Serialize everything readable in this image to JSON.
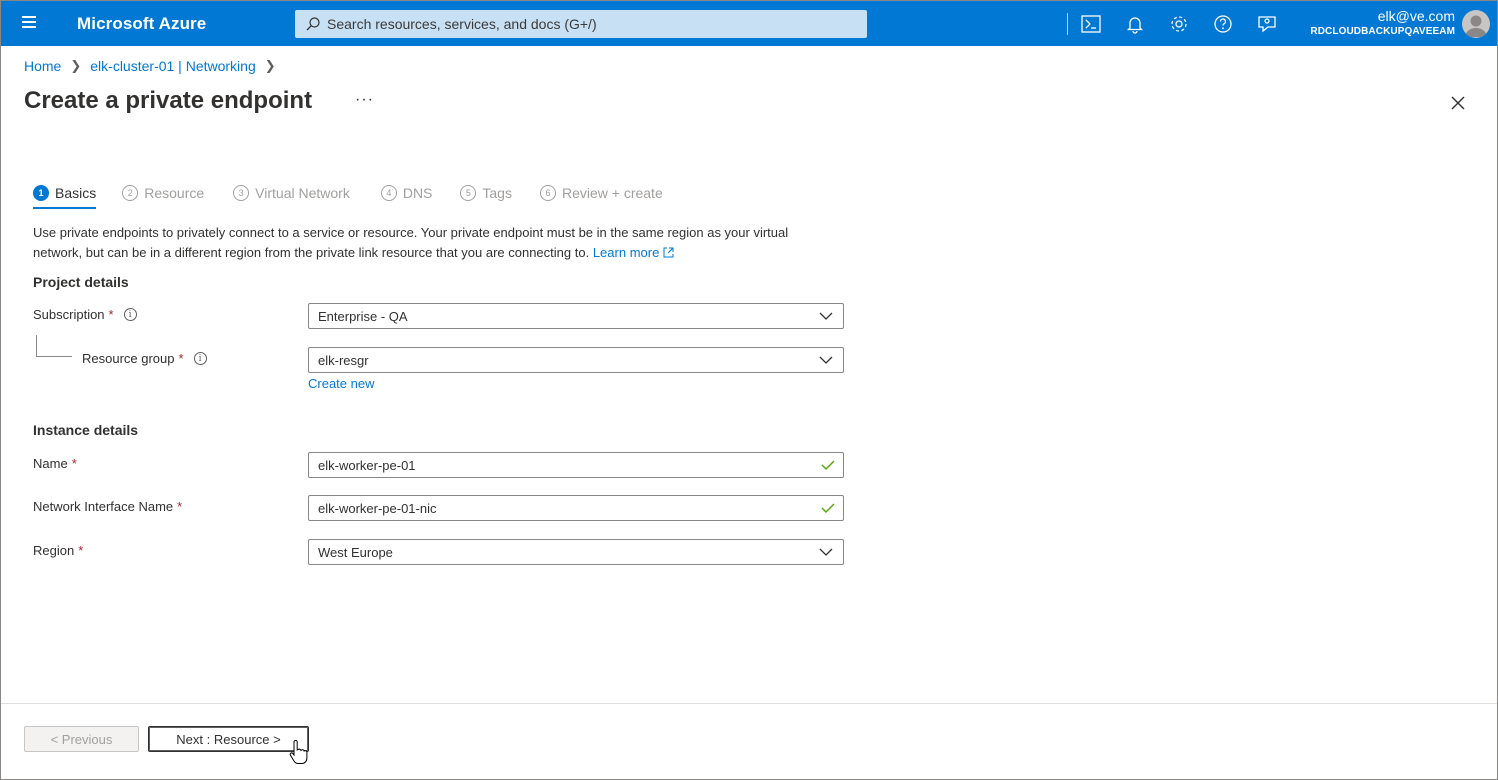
{
  "topbar": {
    "brand": "Microsoft Azure",
    "search_placeholder": "Search resources, services, and docs (G+/)",
    "account_email": "elk@ve.com",
    "account_tenant": "RDCLOUDBACKUPQAVEEAM",
    "icons": [
      "cloud-shell-icon",
      "bell-icon",
      "gear-icon",
      "help-icon",
      "feedback-icon"
    ],
    "accent": "#0078d4"
  },
  "breadcrumb": {
    "home": "Home",
    "resource": "elk-cluster-01 | Networking"
  },
  "page": {
    "title": "Create a private endpoint",
    "more": "···"
  },
  "tabs": [
    {
      "num": "1",
      "label": "Basics",
      "active": true
    },
    {
      "num": "2",
      "label": "Resource"
    },
    {
      "num": "3",
      "label": "Virtual Network"
    },
    {
      "num": "4",
      "label": "DNS"
    },
    {
      "num": "5",
      "label": "Tags"
    },
    {
      "num": "6",
      "label": "Review + create"
    }
  ],
  "description": {
    "text": "Use private endpoints to privately connect to a service or resource. Your private endpoint must be in the same region as your virtual network, but can be in a different region from the private link resource that you are connecting to.",
    "link": "Learn more"
  },
  "project": {
    "heading": "Project details",
    "subscription_label": "Subscription",
    "subscription_value": "Enterprise - QA",
    "rg_label": "Resource group",
    "rg_value": "elk-resgr",
    "create_new": "Create new"
  },
  "instance": {
    "heading": "Instance details",
    "name_label": "Name",
    "name_value": "elk-worker-pe-01",
    "nic_label": "Network Interface Name",
    "nic_value": "elk-worker-pe-01-nic",
    "region_label": "Region",
    "region_value": "West Europe"
  },
  "footer": {
    "previous": "< Previous",
    "next": "Next : Resource >"
  },
  "required_mark": "*",
  "info_mark": "i"
}
